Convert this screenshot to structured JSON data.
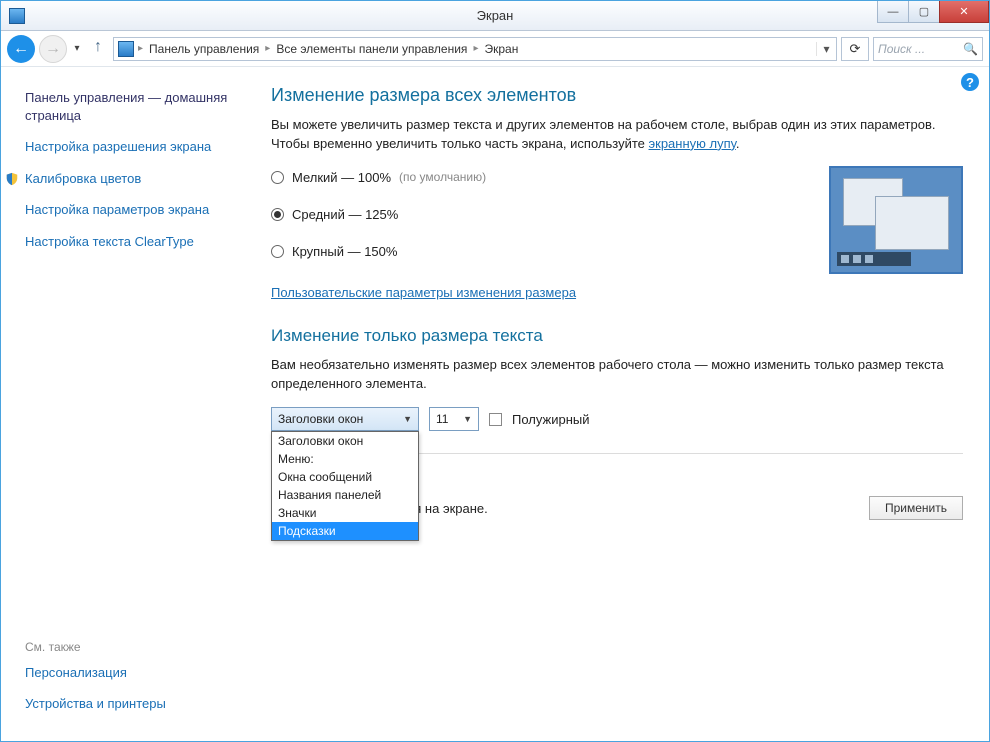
{
  "window": {
    "title": "Экран",
    "minimize": "—",
    "maximize": "▢",
    "close": "✕"
  },
  "nav": {
    "back": "←",
    "forward": "→",
    "up": "↑",
    "refresh": "⟳",
    "search_placeholder": "Поиск ...",
    "search_icon": "🔍",
    "breadcrumbs": [
      "Панель управления",
      "Все элементы панели управления",
      "Экран"
    ]
  },
  "sidebar": {
    "home": "Панель управления — домашняя страница",
    "items": [
      "Настройка разрешения экрана",
      "Калибровка цветов",
      "Настройка параметров экрана",
      "Настройка текста ClearType"
    ],
    "see_also_label": "См. также",
    "see_also": [
      "Персонализация",
      "Устройства и принтеры"
    ]
  },
  "main": {
    "heading1": "Изменение размера всех элементов",
    "intro_a": "Вы можете увеличить размер текста и других элементов на рабочем столе, выбрав один из этих параметров. Чтобы временно увеличить только часть экрана, используйте ",
    "intro_link": "экранную лупу",
    "intro_b": ".",
    "radios": {
      "small": "Мелкий — 100%",
      "small_note": "(по умолчанию)",
      "medium": "Средний — 125%",
      "large": "Крупный — 150%"
    },
    "custom_link": "Пользовательские параметры изменения размера",
    "heading2": "Изменение только размера текста",
    "text_only": "Вам необязательно изменять размер всех элементов рабочего стола — можно изменить только размер текста определенного элемента.",
    "element_combo": "Заголовки окон",
    "size_combo": "11",
    "bold_label": "Полужирный",
    "dropdown_options": [
      "Заголовки окон",
      "Меню:",
      "Окна сообщений",
      "Названия панелей",
      "Значки",
      "Подсказки"
    ],
    "selected_option_index": 5,
    "footer_warn": "ты могут не поместиться на экране.",
    "apply": "Применить"
  }
}
